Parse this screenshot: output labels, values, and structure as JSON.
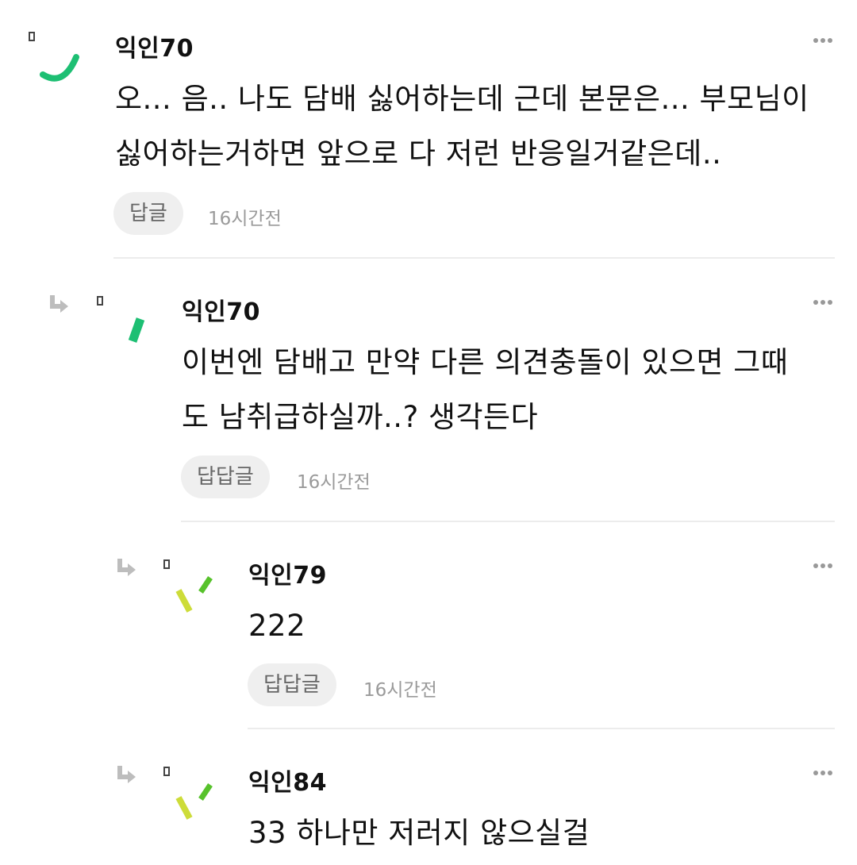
{
  "comments": [
    {
      "username": "익인70",
      "lines": [
        "오... 음.. 나도 담배 싫어하는데 근데 본문은... 부모님이",
        "싫어하는거하면 앞으로 다 저런 반응일거같은데.."
      ],
      "reply_label": "답글",
      "time": "16시간전",
      "avatar_icon": "green-arc-avatar-icon",
      "more_icon": "more-dots-icon"
    },
    {
      "username": "익인70",
      "lines": [
        "이번엔 담배고 만약 다른 의견충돌이 있으면 그때",
        "도 남취급하실까..? 생각든다"
      ],
      "reply_label": "답답글",
      "time": "16시간전",
      "avatar_icon": "green-dash-avatar-icon",
      "reply_icon": "reply-arrow-icon",
      "more_icon": "more-dots-icon"
    },
    {
      "username": "익인79",
      "lines": [
        "222"
      ],
      "reply_label": "답답글",
      "time": "16시간전",
      "avatar_icon": "yellow-green-marks-avatar-icon",
      "reply_icon": "reply-arrow-icon",
      "more_icon": "more-dots-icon"
    },
    {
      "username": "익인84",
      "lines": [
        "33 하나만 저러지 않으실걸"
      ],
      "avatar_icon": "yellow-green-marks-avatar-icon",
      "reply_icon": "reply-arrow-icon",
      "more_icon": "more-dots-icon"
    }
  ],
  "colors": {
    "avatar_green": "#1dbf73",
    "avatar_lime": "#57c22b",
    "avatar_yellow": "#cddc39",
    "reply_button_bg": "#efefef",
    "reply_button_text": "#666666",
    "time_text": "#9a9a9a",
    "divider": "#ececec",
    "reply_arrow": "#bdbdbd"
  }
}
